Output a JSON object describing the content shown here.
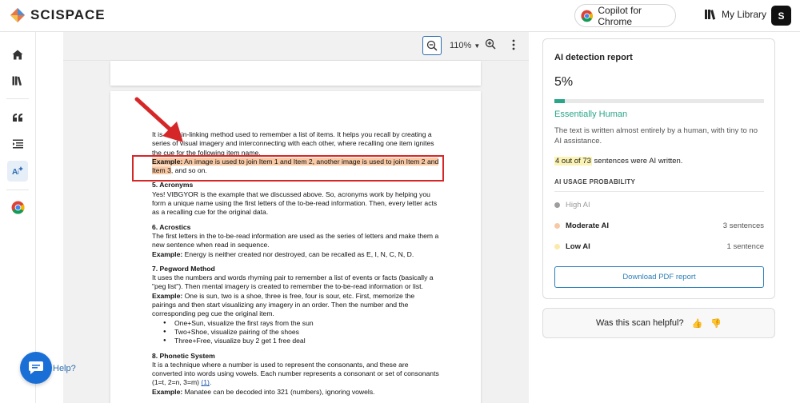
{
  "brand": {
    "name": "SCISPACE"
  },
  "header": {
    "copilot_label": "Copilot for Chrome",
    "library_label": "My Library",
    "avatar_initial": "S"
  },
  "toolbar": {
    "zoom_level": "110%"
  },
  "document": {
    "intro": "It is a chain-linking method used to remember a list of items. It helps you recall by creating a series of visual imagery and interconnecting with each other, where recalling one item ignites the cue for the following item name.",
    "example_label": "Example:",
    "example_text": "An image is used to join Item 1 and Item 2, another image is used to join Item 2 and Item 3",
    "example_tail": ", and so on.",
    "acronyms_heading": "5. Acronyms",
    "acronyms_text": "Yes! VIBGYOR is the example that we discussed above. So, acronyms work by helping you form a unique name using the first letters of the to-be-read information. Then, every letter acts as a recalling cue for the original data.",
    "acrostics_heading": "6. Acrostics",
    "acrostics_text": "The first letters in the to-be-read information are used as the series of letters and make them a new sentence when read in sequence.",
    "acrostics_example_label": "Example:",
    "acrostics_example": "Energy is neither created nor destroyed, can be recalled as E, I, N, C, N, D.",
    "peg_heading": "7. Pegword Method",
    "peg_text": "It uses the numbers and words rhyming pair to remember a list of events or facts (basically a \"peg list\"). Then mental imagery is created to remember the to-be-read information or list.",
    "peg_example_label": "Example:",
    "peg_example": "One is sun, two is a shoe, three is free, four is sour, etc. First, memorize the pairings and then start visualizing any imagery in an order. Then the number and the corresponding peg cue the original item.",
    "peg_bullets": [
      "One+Sun, visualize the first rays from the sun",
      "Two+Shoe, visualize pairing of the shoes",
      "Three+Free, visualize buy 2 get 1 free deal"
    ],
    "phonetic_heading": "8. Phonetic System",
    "phonetic_text": "It is a technique where a number is used to represent the consonants, and these are converted into words using vowels. Each number represents a consonant or set of consonants (1=t, 2=n, 3=m)",
    "phonetic_ref": "(1)",
    "phonetic_tail": ".",
    "phonetic_example_label": "Example:",
    "phonetic_example": "Manatee can be decoded into 321 (numbers), ignoring vowels."
  },
  "help": {
    "label": "Help?"
  },
  "report": {
    "title": "AI detection report",
    "score": "5%",
    "score_fraction": 0.05,
    "verdict": "Essentially Human",
    "description": "The text is written almost entirely by a human, with tiny to no AI assistance.",
    "count_highlight": "4 out of 73",
    "count_suffix": " sentences were AI written.",
    "usage_title": "AI USAGE PROBABILITY",
    "rows": [
      {
        "label": "High AI",
        "value": "",
        "color": "#9e9e9e",
        "muted": true
      },
      {
        "label": "Moderate AI",
        "value": "3 sentences",
        "color": "#f6c9a6",
        "muted": false
      },
      {
        "label": "Low AI",
        "value": "1 sentence",
        "color": "#fbeaa8",
        "muted": false
      }
    ],
    "download_label": "Download PDF report"
  },
  "feedback": {
    "question": "Was this scan helpful?",
    "up": "👍",
    "down": "👎"
  },
  "colors": {
    "accent": "#2aa58a",
    "link": "#2a7fb8",
    "highlight": "#f8c9a4",
    "annotation": "#d62728"
  }
}
